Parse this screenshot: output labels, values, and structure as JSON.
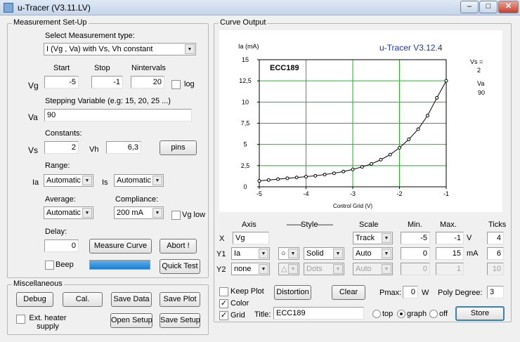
{
  "window": {
    "title": "u-Tracer (V3.11.LV)",
    "minimize_label": "–",
    "maximize_label": "□",
    "close_label": "✕"
  },
  "setup": {
    "group_label": "Measurement Set-Up",
    "type_label": "Select Measurement type:",
    "type_value": "I (Vg , Va) with Vs, Vh constant",
    "col_start": "Start",
    "col_stop": "Stop",
    "col_nintervals": "Nintervals",
    "vg_label": "Vg",
    "vg_start": "-5",
    "vg_stop": "-1",
    "vg_nintervals": "20",
    "log_label": "log",
    "log_checked": false,
    "stepping_label": "Stepping Variable (e.g: 15, 20, 25 ...)",
    "va_label": "Va",
    "va_value": "90",
    "constants_label": "Constants:",
    "vs_label": "Vs",
    "vs_value": "2",
    "vh_label": "Vh",
    "vh_value": "6,3",
    "pins_label": "pins",
    "range_label": "Range:",
    "ia_label": "Ia",
    "ia_range": "Automatic",
    "is_label": "Is",
    "is_range": "Automatic",
    "average_label": "Average:",
    "average_value": "Automatic",
    "compliance_label": "Compliance:",
    "compliance_value": "200 mA",
    "vglow_label": "Vg low",
    "vglow_checked": false,
    "delay_label": "Delay:",
    "delay_value": "0",
    "measure_label": "Measure Curve",
    "abort_label": "Abort !",
    "beep_label": "Beep",
    "beep_checked": false,
    "progress": 1.0,
    "quicktest_label": "Quick Test"
  },
  "misc": {
    "group_label": "Miscellaneous",
    "debug_label": "Debug",
    "cal_label": "Cal.",
    "save_data_label": "Save Data",
    "save_plot_label": "Save Plot",
    "ext_heater_label": "Ext. heater supply",
    "ext_heater_checked": false,
    "open_setup_label": "Open Setup",
    "save_setup_label": "Save Setup"
  },
  "curve": {
    "group_label": "Curve Output",
    "plot_title": "u-Tracer V3.12.4",
    "side_vs_label": "Vs =",
    "side_vs_value": "2",
    "side_va_label": "Va",
    "side_va_value": "90",
    "head_axis": "Axis",
    "head_style": "Style",
    "head_scale": "Scale",
    "head_min": "Min.",
    "head_max": "Max.",
    "head_ticks": "Ticks",
    "row_x_label": "X",
    "x_axis": "Vg",
    "x_scale": "Track",
    "x_min": "-5",
    "x_max": "-1",
    "x_unit": "V",
    "x_ticks": "4",
    "row_y1_label": "Y1",
    "y1_axis": "Ia",
    "y1_marker": "○",
    "y1_line": "Solid",
    "y1_scale": "Auto",
    "y1_min": "0",
    "y1_max": "15",
    "y1_unit": "mA",
    "y1_ticks": "6",
    "row_y2_label": "Y2",
    "y2_axis": "none",
    "y2_marker": "△",
    "y2_line": "Dots",
    "y2_scale": "Auto",
    "y2_min": "0",
    "y2_max": "1",
    "y2_ticks": "10",
    "keep_plot_label": "Keep Plot",
    "keep_plot_checked": false,
    "color_label": "Color",
    "color_checked": true,
    "grid_label": "Grid",
    "grid_checked": true,
    "distortion_label": "Distortion",
    "clear_label": "Clear",
    "pmax_label": "Pmax:",
    "pmax_value": "0",
    "pmax_unit": "W",
    "poly_label": "Poly Degree:",
    "poly_value": "3",
    "title_label": "Title:",
    "title_value": "ECC189",
    "pos_top": "top",
    "pos_graph": "graph",
    "pos_off": "off",
    "pos_selected": "graph",
    "store_label": "Store"
  },
  "chart_data": {
    "type": "line",
    "title": "ECC189",
    "xlabel": "Control Grid (V)",
    "ylabel": "Ia (mA)",
    "xlim": [
      -5,
      -1
    ],
    "ylim": [
      0,
      15
    ],
    "xticks": [
      "-5",
      "-4",
      "-3",
      "-2",
      "-1"
    ],
    "yticks": [
      "0",
      "2,5",
      "5",
      "7,5",
      "10",
      "12,5",
      "15"
    ],
    "grid": true,
    "grid_color": "#22b522",
    "series": [
      {
        "color": "#000000",
        "marker": "circle",
        "x": [
          -5,
          -4.8,
          -4.6,
          -4.4,
          -4.2,
          -4,
          -3.8,
          -3.6,
          -3.4,
          -3.2,
          -3,
          -2.8,
          -2.6,
          -2.4,
          -2.2,
          -2,
          -1.8,
          -1.6,
          -1.4,
          -1.2,
          -1
        ],
        "y": [
          0.7,
          0.8,
          0.9,
          1.0,
          1.1,
          1.2,
          1.3,
          1.45,
          1.6,
          1.8,
          2.05,
          2.35,
          2.7,
          3.2,
          3.8,
          4.6,
          5.6,
          6.8,
          8.4,
          10.5,
          12.5
        ]
      }
    ]
  }
}
